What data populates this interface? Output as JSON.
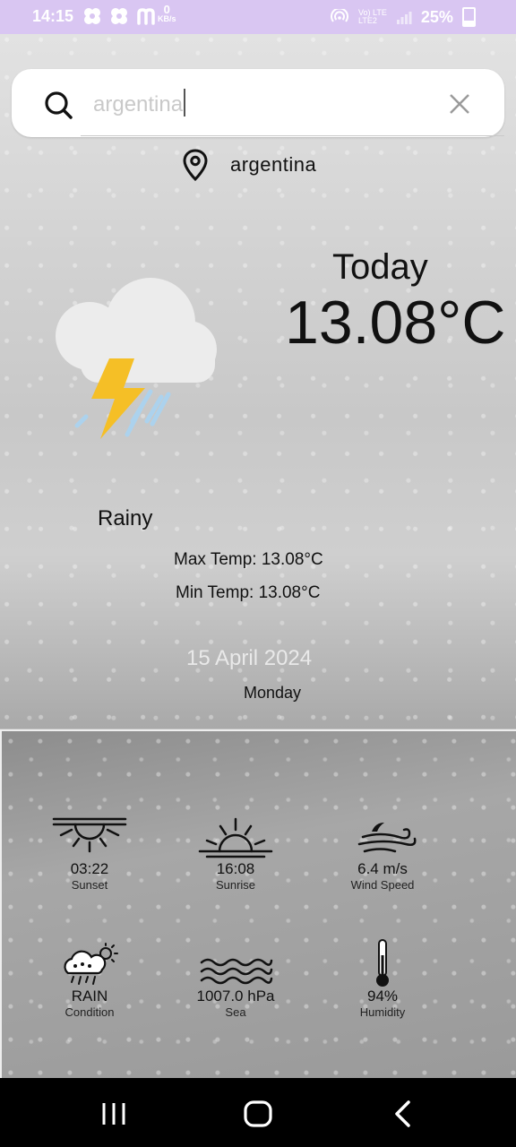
{
  "status_bar": {
    "time": "14:15",
    "kbs_value": "0",
    "kbs_unit": "KB/s",
    "network_top": "Vo) LTE",
    "network_bottom": "LTE2",
    "battery": "25%"
  },
  "search": {
    "value": "argentina",
    "search_icon": "search-icon",
    "clear_icon": "close-icon"
  },
  "location": {
    "name": "argentina",
    "icon": "map-pin-icon"
  },
  "current": {
    "label": "Today",
    "temperature": "13.08°C",
    "condition": "Rainy",
    "max_temp": "Max Temp: 13.08°C",
    "min_temp": "Min Temp: 13.08°C",
    "date": "15 April 2024",
    "day": "Monday",
    "illustration": "thunderstorm-cloud-icon"
  },
  "details": [
    {
      "value": "03:22",
      "label": "Sunset",
      "icon": "sunset-icon"
    },
    {
      "value": "16:08",
      "label": "Sunrise",
      "icon": "sunrise-icon"
    },
    {
      "value": "6.4 m/s",
      "label": "Wind Speed",
      "icon": "wind-icon"
    },
    {
      "value": "RAIN",
      "label": "Condition",
      "icon": "rain-cloud-icon"
    },
    {
      "value": "1007.0 hPa",
      "label": "Sea",
      "icon": "sea-waves-icon"
    },
    {
      "value": "94%",
      "label": "Humidity",
      "icon": "thermometer-icon"
    }
  ],
  "colors": {
    "status_bar": "#d9c6f2",
    "bolt": "#f5bf26",
    "rain_streak": "#a9d4f2",
    "nav_bar": "#000000"
  },
  "nav": {
    "recents": "recents-icon",
    "home": "home-icon",
    "back": "back-icon"
  }
}
